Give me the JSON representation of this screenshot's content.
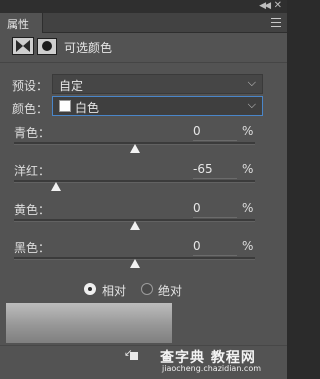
{
  "panel": {
    "tab_label": "属性",
    "adjustment_title": "可选颜色"
  },
  "preset": {
    "label": "预设：",
    "value": "自定"
  },
  "colors": {
    "label": "颜色：",
    "value": "白色",
    "swatch_color": "#ffffff"
  },
  "sliders": [
    {
      "label": "青色：",
      "value": "0",
      "unit": "%",
      "level": 0
    },
    {
      "label": "洋红：",
      "value": "-65",
      "unit": "%",
      "level": -65
    },
    {
      "label": "黄色：",
      "value": "0",
      "unit": "%",
      "level": 0
    },
    {
      "label": "黑色：",
      "value": "0",
      "unit": "%",
      "level": 0
    }
  ],
  "method": {
    "options": [
      "相对",
      "绝对"
    ],
    "selected": "相对"
  },
  "watermark": {
    "line1": "查字典 教程网",
    "line2": "jiaocheng.chazidian.com"
  },
  "icons": [
    "double-arrow-icon",
    "close-icon",
    "panel-menu-icon",
    "adjustment-icon",
    "layer-mask-icon",
    "chevron-down-icon",
    "clip-to-layer-icon",
    "visibility-icon"
  ]
}
